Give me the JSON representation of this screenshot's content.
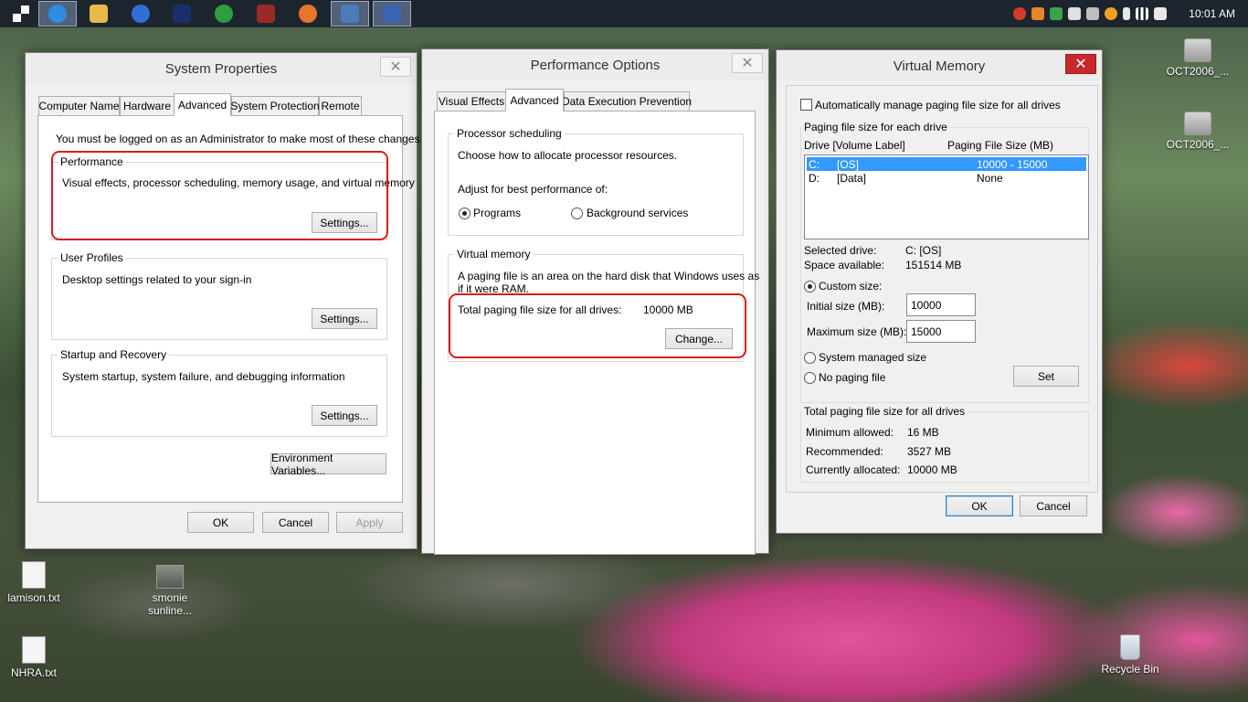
{
  "taskbar": {
    "apps": [
      {
        "icon": "start-icon",
        "color": "#ffffff"
      },
      {
        "icon": "internet-explorer-icon",
        "color": "#2f8ce0"
      },
      {
        "icon": "file-explorer-icon",
        "color": "#e8b84a"
      },
      {
        "icon": "email-client-icon",
        "color": "#2f6fd6"
      },
      {
        "icon": "media-app-icon",
        "color": "#1a2f6a"
      },
      {
        "icon": "camera-app-icon",
        "color": "#2e9e3e"
      },
      {
        "icon": "tool-app-icon",
        "color": "#9a2a2a"
      },
      {
        "icon": "firefox-icon",
        "color": "#e8762a"
      },
      {
        "icon": "system-properties-icon",
        "color": "#4a7db8"
      },
      {
        "icon": "performance-options-icon",
        "color": "#3b64b0"
      }
    ],
    "tray_icons": [
      "antivirus-tray-icon",
      "update-tray-icon",
      "security-tray-icon",
      "flag-tray-icon",
      "printer-tray-icon",
      "sync-tray-icon",
      "battery-tray-icon",
      "signal-tray-icon",
      "volume-tray-icon"
    ],
    "clock": "10:01 AM"
  },
  "desktop": {
    "icons": [
      {
        "label": "OCT2006_...",
        "icon": "drive-icon"
      },
      {
        "label": "OCT2006_...",
        "icon": "drive-icon"
      },
      {
        "label": "lamison.txt",
        "icon": "text-file-icon"
      },
      {
        "label": "smonie sunline...",
        "icon": "image-file-icon"
      },
      {
        "label": "NHRA.txt",
        "icon": "text-file-icon"
      },
      {
        "label": "Recycle Bin",
        "icon": "recycle-bin-icon"
      }
    ]
  },
  "system_properties": {
    "title": "System Properties",
    "tabs": [
      "Computer Name",
      "Hardware",
      "Advanced",
      "System Protection",
      "Remote"
    ],
    "admin_note": "You must be logged on as an Administrator to make most of these changes.",
    "performance": {
      "label": "Performance",
      "desc": "Visual effects, processor scheduling, memory usage, and virtual memory",
      "button": "Settings..."
    },
    "user_profiles": {
      "label": "User Profiles",
      "desc": "Desktop settings related to your sign-in",
      "button": "Settings..."
    },
    "startup": {
      "label": "Startup and Recovery",
      "desc": "System startup, system failure, and debugging information",
      "button": "Settings..."
    },
    "env_button": "Environment Variables...",
    "ok": "OK",
    "cancel": "Cancel",
    "apply": "Apply"
  },
  "performance_options": {
    "title": "Performance Options",
    "tabs": [
      "Visual Effects",
      "Advanced",
      "Data Execution Prevention"
    ],
    "scheduling": {
      "label": "Processor scheduling",
      "desc": "Choose how to allocate processor resources.",
      "adjust": "Adjust for best performance of:",
      "opt_programs": "Programs",
      "opt_background": "Background services",
      "selected": "Programs"
    },
    "virtual_memory": {
      "label": "Virtual memory",
      "desc1": "A paging file is an area on the hard disk that Windows uses as",
      "desc2": "if it were RAM.",
      "total_label": "Total paging file size for all drives:",
      "total_value": "10000 MB",
      "button": "Change..."
    }
  },
  "virtual_memory": {
    "title": "Virtual Memory",
    "auto_manage": "Automatically manage paging file size for all drives",
    "auto_checked": false,
    "group_label": "Paging file size for each drive",
    "col_drive": "Drive  [Volume Label]",
    "col_size": "Paging File Size (MB)",
    "drives": [
      {
        "drive": "C:",
        "label": "[OS]",
        "size": "10000 - 15000",
        "selected": true
      },
      {
        "drive": "D:",
        "label": "[Data]",
        "size": "None",
        "selected": false
      }
    ],
    "selected_drive_label": "Selected drive:",
    "selected_drive_value": "C:  [OS]",
    "space_label": "Space available:",
    "space_value": "151514 MB",
    "custom_size": "Custom size:",
    "initial_label": "Initial size (MB):",
    "initial_value": "10000",
    "max_label": "Maximum size (MB):",
    "max_value": "15000",
    "system_managed": "System managed size",
    "no_paging": "No paging file",
    "size_mode": "Custom size",
    "set_button": "Set",
    "totals_label": "Total paging file size for all drives",
    "min_label": "Minimum allowed:",
    "min_value": "16 MB",
    "rec_label": "Recommended:",
    "rec_value": "3527 MB",
    "cur_label": "Currently allocated:",
    "cur_value": "10000 MB",
    "ok": "OK",
    "cancel": "Cancel"
  }
}
